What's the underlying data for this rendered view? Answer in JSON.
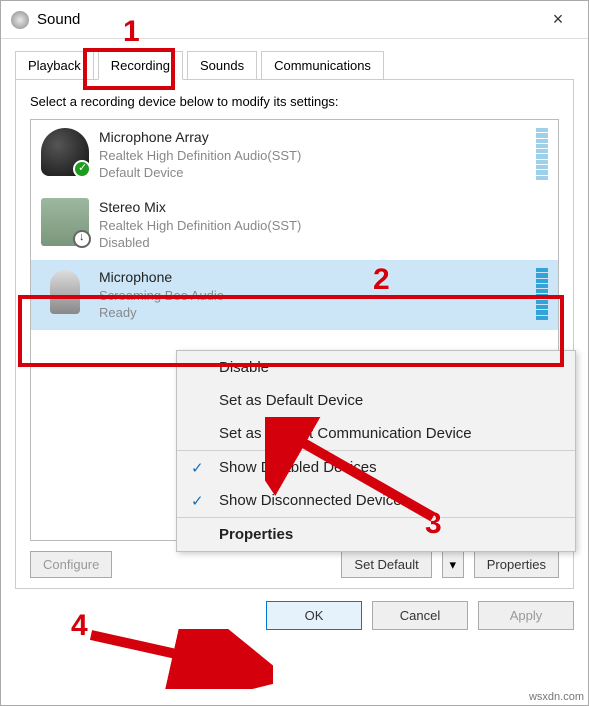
{
  "window": {
    "title": "Sound"
  },
  "tabs": {
    "playback": "Playback",
    "recording": "Recording",
    "sounds": "Sounds",
    "comm": "Communications"
  },
  "instruction": "Select a recording device below to modify its settings:",
  "devices": [
    {
      "name": "Microphone Array",
      "driver": "Realtek High Definition Audio(SST)",
      "status": "Default Device"
    },
    {
      "name": "Stereo Mix",
      "driver": "Realtek High Definition Audio(SST)",
      "status": "Disabled"
    },
    {
      "name": "Microphone",
      "driver": "Screaming Bee Audio",
      "status": "Ready"
    }
  ],
  "context": {
    "disable": "Disable",
    "set_default": "Set as Default Device",
    "set_comm": "Set as Default Communication Device",
    "show_disabled": "Show Disabled Devices",
    "show_disconn": "Show Disconnected Devices",
    "properties": "Properties"
  },
  "panel_buttons": {
    "configure": "Configure",
    "setdefault": "Set Default",
    "properties": "Properties"
  },
  "footer": {
    "ok": "OK",
    "cancel": "Cancel",
    "apply": "Apply"
  },
  "annotations": {
    "n1": "1",
    "n2": "2",
    "n3": "3",
    "n4": "4"
  },
  "watermark": "wsxdn.com"
}
